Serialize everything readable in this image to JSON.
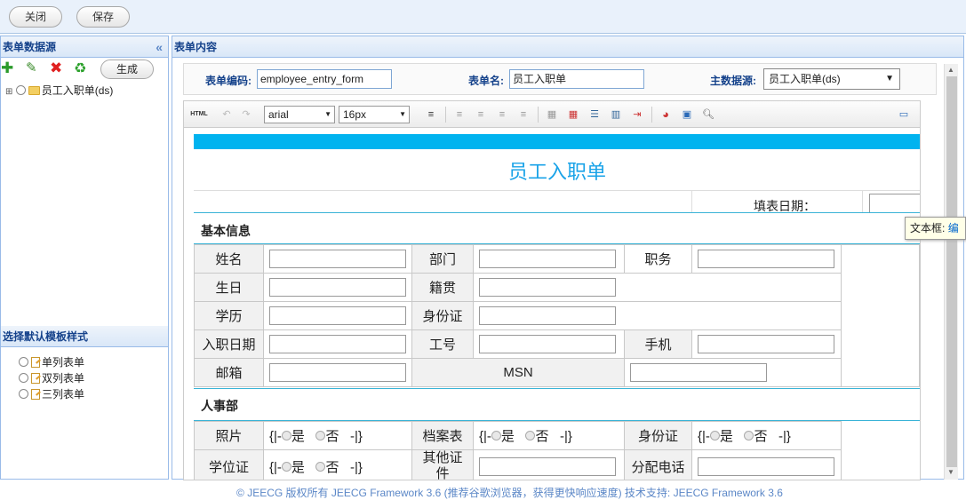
{
  "toolbar": {
    "close_label": "关闭",
    "save_label": "保存"
  },
  "left_panel": {
    "title": "表单数据源",
    "generate_label": "生成",
    "tree": [
      {
        "label": "员工入职单(ds)"
      }
    ]
  },
  "template_panel": {
    "title": "选择默认模板样式",
    "options": [
      {
        "label": "单列表单"
      },
      {
        "label": "双列表单"
      },
      {
        "label": "三列表单"
      }
    ]
  },
  "main": {
    "title": "表单内容",
    "code_label": "表单编码:",
    "code_value": "employee_entry_form",
    "name_label": "表单名:",
    "name_value": "员工入职单",
    "ds_label": "主数据源:",
    "ds_value": "员工入职单(ds)"
  },
  "editor": {
    "font_family": "arial",
    "font_size": "16px",
    "doc_title": "员工入职单",
    "date_label": "填表日期：",
    "section_basic": "基本信息",
    "section_hr": "人事部",
    "basic": {
      "name": "姓名",
      "dept": "部门",
      "post": "职务",
      "birthday": "生日",
      "native": "籍贯",
      "education": "学历",
      "id_card": "身份证",
      "entry_date": "入职日期",
      "job_no": "工号",
      "mobile": "手机",
      "email": "邮箱",
      "msn": "MSN"
    },
    "hr": {
      "photo": "照片",
      "archive": "档案表",
      "id_card": "身份证",
      "degree": "学位证",
      "other_cert": "其他证件",
      "phone": "分配电话",
      "radio_prefix": "{|-",
      "radio_yes": "是",
      "radio_no": "否",
      "radio_suffix": "-|}"
    }
  },
  "tooltip": {
    "text": "文本框:",
    "link": "编"
  },
  "footer": "© JEECG 版权所有  JEECG Framework 3.6 (推荐谷歌浏览器，获得更快响应速度) 技术支持: JEECG Framework 3.6"
}
